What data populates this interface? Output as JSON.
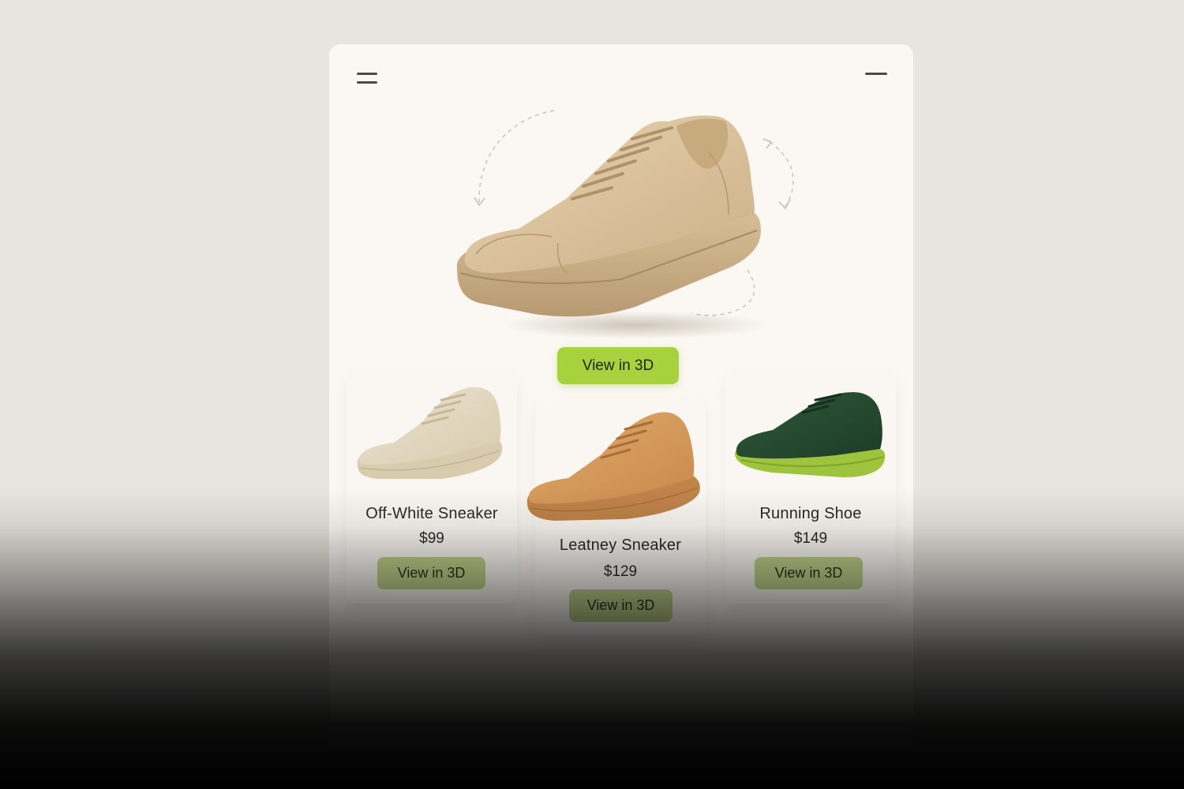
{
  "header": {
    "menu_icon": "hamburger-menu-icon",
    "minimize_icon": "minimize-icon"
  },
  "hero": {
    "product_image": "beige-sneaker-3d-preview",
    "rotate_indicator": "rotate-arrows-icon",
    "cta_label": "View in 3D",
    "cta_color": "#a7d13d"
  },
  "products": [
    {
      "name": "Off-White Sneaker",
      "price": "$99",
      "cta_label": "View in 3D",
      "image": "off-white-sneaker"
    },
    {
      "name": "Leatney Sneaker",
      "price": "$129",
      "cta_label": "View in 3D",
      "image": "tan-leather-sneaker"
    },
    {
      "name": "Running Shoe",
      "price": "$149",
      "cta_label": "View in 3D",
      "image": "green-running-shoe"
    }
  ],
  "colors": {
    "background": "#e8e4de",
    "card": "#fbf8f3",
    "accent": "#a7d13d",
    "secondary_button": "#bfd08a"
  }
}
